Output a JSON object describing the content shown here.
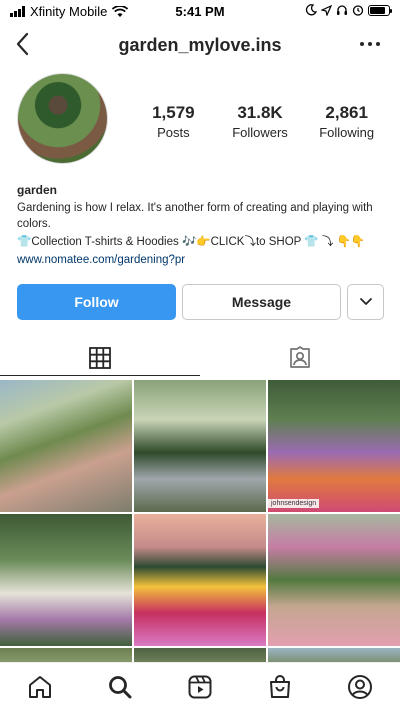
{
  "status_bar": {
    "carrier": "Xfinity Mobile",
    "time": "5:41 PM"
  },
  "header": {
    "username": "garden_mylove.ins"
  },
  "profile": {
    "stats": [
      {
        "value": "1,579",
        "label": "Posts"
      },
      {
        "value": "31.8K",
        "label": "Followers"
      },
      {
        "value": "2,861",
        "label": "Following"
      }
    ],
    "name": "garden",
    "bio_line1": "Gardening is how I relax. It's another form of creating and playing with colors.",
    "bio_line2": "👕Collection T-shirts & Hoodies 🎶👉CLICK⤵to SHOP 👕 ⤵ 👇👇",
    "link": "www.nomatee.com/gardening?pr"
  },
  "actions": {
    "follow_label": "Follow",
    "message_label": "Message"
  },
  "grid": {
    "credit_text": "johnsendesign"
  },
  "nav": {
    "items": [
      "home-icon",
      "search-icon",
      "reels-icon",
      "shop-icon",
      "profile-icon"
    ]
  }
}
